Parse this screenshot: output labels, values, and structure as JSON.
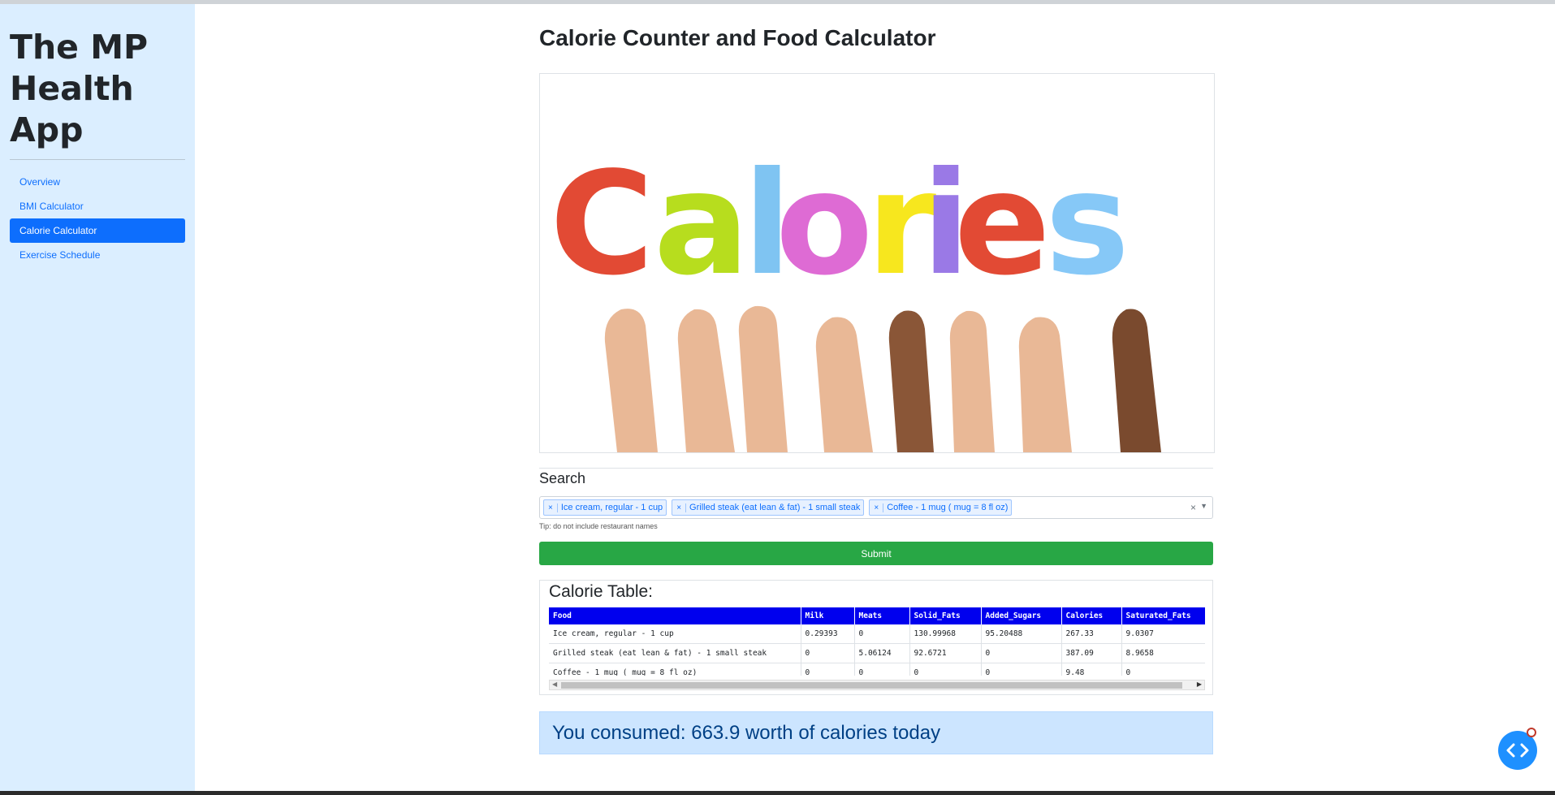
{
  "sidebar": {
    "brand": "The MP Health App",
    "items": [
      {
        "label": "Overview",
        "active": false
      },
      {
        "label": "BMI Calculator",
        "active": false
      },
      {
        "label": "Calorie Calculator",
        "active": true
      },
      {
        "label": "Exercise Schedule",
        "active": false
      }
    ]
  },
  "main": {
    "title": "Calorie Counter and Food Calculator",
    "hero_text": "Calories",
    "hero_letter_colors": [
      "#e24a34",
      "#b7dd1e",
      "#7fc4f2",
      "#de6bd4",
      "#f7e71e",
      "#9a79e6",
      "#e24a34",
      "#86c8f7"
    ]
  },
  "search": {
    "label": "Search",
    "selected": [
      "Ice cream, regular - 1 cup",
      "Grilled steak (eat lean & fat) - 1 small steak",
      "Coffee - 1 mug ( mug = 8 fl oz)"
    ],
    "chip_remove": "×",
    "clear": "×",
    "tip": "Tip: do not include restaurant names",
    "submit_label": "Submit"
  },
  "calorie_table": {
    "title": "Calorie Table:",
    "columns": [
      "Food",
      "Milk",
      "Meats",
      "Solid_Fats",
      "Added_Sugars",
      "Calories",
      "Saturated_Fats"
    ],
    "rows": [
      [
        "Ice cream, regular - 1 cup",
        "0.29393",
        "0",
        "130.99968",
        "95.20488",
        "267.33",
        "9.0307"
      ],
      [
        "Grilled steak (eat lean & fat) - 1 small steak",
        "0",
        "5.06124",
        "92.6721",
        "0",
        "387.09",
        "8.9658"
      ],
      [
        "Coffee - 1 mug ( mug = 8 fl oz)",
        "0",
        "0",
        "0",
        "0",
        "9.48",
        "0"
      ]
    ]
  },
  "summary": {
    "text": "You consumed: 663.9 worth of calories today"
  },
  "colors": {
    "sidebar_bg": "#dbeeff",
    "active_nav": "#0d6efd",
    "table_header": "#0000ee",
    "submit": "#28a745",
    "alert_bg": "#cce5ff"
  }
}
